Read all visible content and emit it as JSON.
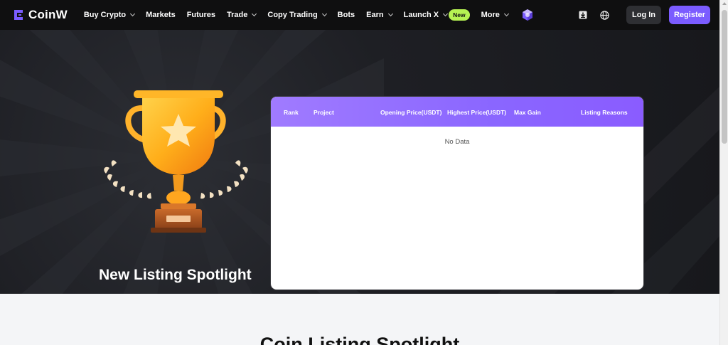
{
  "brand": {
    "name": "CoinW"
  },
  "nav": {
    "items": [
      {
        "label": "Buy Crypto",
        "dropdown": true
      },
      {
        "label": "Markets",
        "dropdown": false
      },
      {
        "label": "Futures",
        "dropdown": false
      },
      {
        "label": "Trade",
        "dropdown": true
      },
      {
        "label": "Copy Trading",
        "dropdown": true
      },
      {
        "label": "Bots",
        "dropdown": false
      },
      {
        "label": "Earn",
        "dropdown": true
      },
      {
        "label": "Launch X",
        "dropdown": true
      },
      {
        "label": "More",
        "dropdown": true
      }
    ],
    "launch_badge": "New",
    "login_label": "Log In",
    "register_label": "Register",
    "icons": [
      "download-icon",
      "globe-icon",
      "gem-icon"
    ]
  },
  "hero": {
    "title": "New Listing Spotlight"
  },
  "table": {
    "columns": [
      "Rank",
      "Project",
      "Opening Price(USDT)",
      "Highest Price(USDT)",
      "Max Gain",
      "Listing Reasons"
    ],
    "rows": [],
    "empty_text": "No Data"
  },
  "section": {
    "title": "Coin Listing Spotlight"
  },
  "colors": {
    "accent": "#7b5cff",
    "table_header": "#9470ff",
    "new_badge": "#b6f253",
    "nav_bg": "#0f0f10",
    "hero_bg": "#1e1f24"
  }
}
